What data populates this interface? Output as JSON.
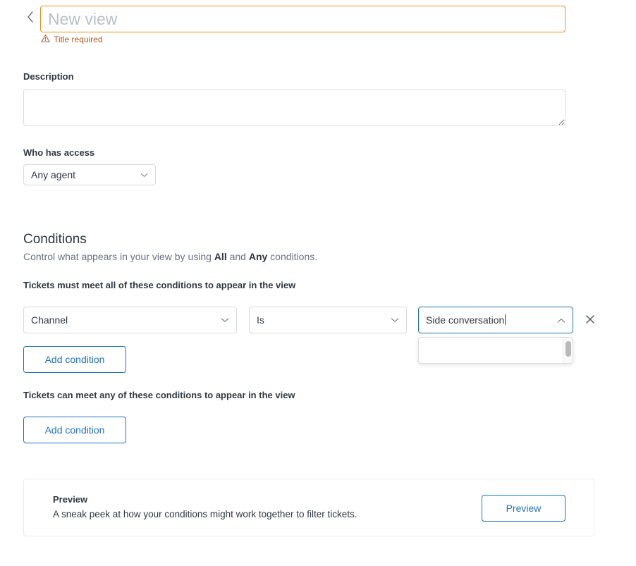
{
  "header": {
    "back_icon": "chevron-left-icon",
    "title_value": "",
    "title_placeholder": "New view",
    "error_text": "Title required",
    "error_icon": "warning-triangle-icon",
    "error_color": "#a6591c",
    "border_color": "#ed8f1c"
  },
  "description": {
    "label": "Description",
    "value": "",
    "placeholder": ""
  },
  "access": {
    "label": "Who has access",
    "selected": "Any agent",
    "chevron_icon": "chevron-down-icon"
  },
  "conditions": {
    "heading": "Conditions",
    "subtitle_before": "Control what appears in your view by using ",
    "subtitle_all": "All",
    "subtitle_middle": " and ",
    "subtitle_any": "Any",
    "subtitle_after": " conditions.",
    "all_group_title": "Tickets must meet all of these conditions to appear in the view",
    "any_group_title": "Tickets can meet any of these conditions to appear in the view",
    "add_condition_label": "Add condition",
    "row": {
      "field": "Channel",
      "field_chevron_icon": "chevron-down-icon",
      "operator": "Is",
      "operator_chevron_icon": "chevron-down-icon",
      "value": "Side conversation",
      "value_chevron_icon": "chevron-up-icon",
      "remove_icon": "close-x-icon",
      "menu_open": true,
      "menu_items": [],
      "focus_color": "#1f73b7"
    }
  },
  "preview": {
    "title": "Preview",
    "description": "A sneak peek at how your conditions might work together to filter tickets.",
    "button_label": "Preview"
  },
  "colors": {
    "accent_blue": "#1f73b7",
    "warning_orange": "#ed8f1c",
    "text_primary": "#2f3941",
    "text_secondary": "#68737d",
    "border_grey": "#d8dcde"
  }
}
